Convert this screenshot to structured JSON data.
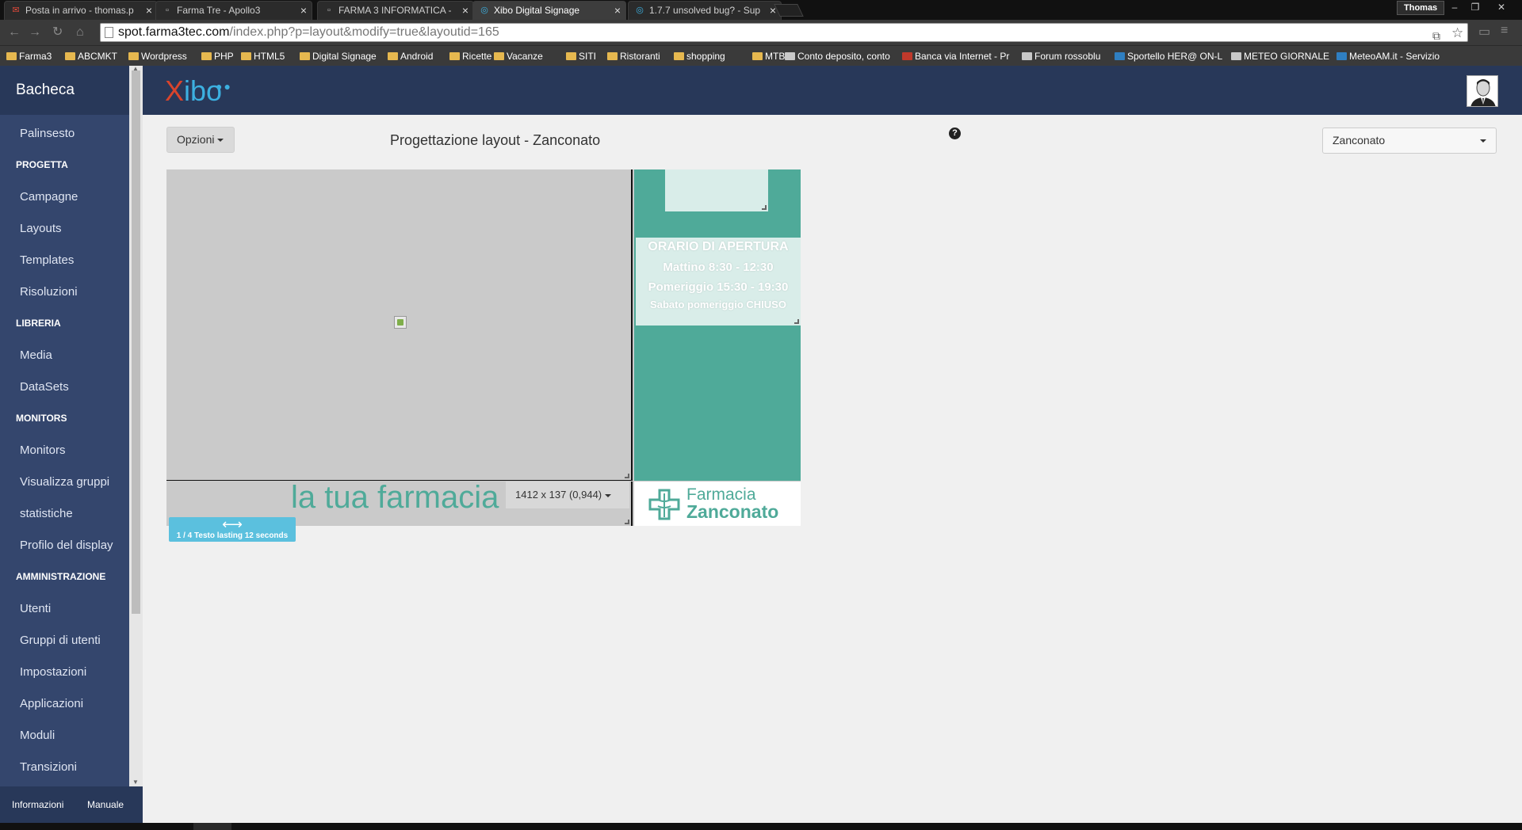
{
  "browser": {
    "tabs": [
      {
        "title": "Posta in arrivo - thomas.p",
        "icon": "gmail-icon",
        "active": false
      },
      {
        "title": "Farma Tre - Apollo3",
        "icon": "page-icon",
        "active": false
      },
      {
        "title": "FARMA 3 INFORMATICA -",
        "icon": "page-icon",
        "active": false
      },
      {
        "title": "Xibo Digital Signage",
        "icon": "xibo-icon",
        "active": true
      },
      {
        "title": "1.7.7 unsolved bug? - Sup",
        "icon": "xibo-icon",
        "active": false
      }
    ],
    "profile_name": "Thomas",
    "url_host": "spot.farma3tec.com",
    "url_path": "/index.php?p=layout&modify=true&layoutid=165",
    "bookmarks": [
      {
        "label": "Farma3",
        "kind": "folder"
      },
      {
        "label": "ABCMKT",
        "kind": "folder"
      },
      {
        "label": "Wordpress",
        "kind": "folder"
      },
      {
        "label": "PHP",
        "kind": "folder"
      },
      {
        "label": "HTML5",
        "kind": "folder"
      },
      {
        "label": "Digital Signage",
        "kind": "folder"
      },
      {
        "label": "Android",
        "kind": "folder"
      },
      {
        "label": "Ricette",
        "kind": "folder"
      },
      {
        "label": "Vacanze",
        "kind": "folder"
      },
      {
        "label": "SITI",
        "kind": "folder"
      },
      {
        "label": "Ristoranti",
        "kind": "folder"
      },
      {
        "label": "shopping",
        "kind": "folder"
      },
      {
        "label": "MTB",
        "kind": "folder"
      },
      {
        "label": "Conto deposito, conto",
        "kind": "site"
      },
      {
        "label": "Banca via Internet - Pr",
        "kind": "red"
      },
      {
        "label": "Forum rossoblu",
        "kind": "site"
      },
      {
        "label": "Sportello HER@ ON-L",
        "kind": "blue"
      },
      {
        "label": "METEO GIORNALE",
        "kind": "site"
      },
      {
        "label": "MeteoAM.it - Servizio",
        "kind": "blue"
      }
    ]
  },
  "sidebar": {
    "brand": "Bacheca",
    "item_palinsesto": "Palinsesto",
    "head_progetta": "PROGETTA",
    "item_campagne": "Campagne",
    "item_layouts": "Layouts",
    "item_templates": "Templates",
    "item_risoluzioni": "Risoluzioni",
    "head_libreria": "LIBRERIA",
    "item_media": "Media",
    "item_datasets": "DataSets",
    "head_monitors": "MONITORS",
    "item_monitors": "Monitors",
    "item_visualizza_gruppi": "Visualizza gruppi",
    "item_statistiche": "statistiche",
    "item_profilo_display": "Profilo del display",
    "head_amministrazione": "AMMINISTRAZIONE",
    "item_utenti": "Utenti",
    "item_gruppi_utenti": "Gruppi di utenti",
    "item_impostazioni": "Impostazioni",
    "item_applicazioni": "Applicazioni",
    "item_moduli": "Moduli",
    "item_transizioni": "Transizioni",
    "footer_informazioni": "Informazioni",
    "footer_manuale": "Manuale"
  },
  "header": {
    "logo_x": "X",
    "logo_rest": "ibo"
  },
  "content": {
    "options_label": "Opzioni",
    "page_title": "Progettazione layout - Zanconato",
    "help_glyph": "?",
    "layout_select_value": "Zanconato"
  },
  "designer": {
    "hours_title": "ORARIO DI APERTURA",
    "hours_morning": "Mattino 8:30 - 12:30",
    "hours_afternoon": "Pomeriggio 15:30 - 19:30",
    "hours_saturday": "Sabato pomeriggio CHIUSO",
    "ticker_text": "la tua farmacia",
    "region_size": "1412 x 137 (0,944)",
    "brand_line1": "Farmacia",
    "brand_line2": "Zanconato",
    "media_badge": "1 / 4 Testo lasting 12 seconds"
  },
  "colors": {
    "sidebar_bg": "#34466d",
    "header_bg": "#283859",
    "accent_teal": "#4faa99",
    "badge_blue": "#5bc0de",
    "logo_red": "#d9442c",
    "logo_blue": "#3cb0e0"
  }
}
